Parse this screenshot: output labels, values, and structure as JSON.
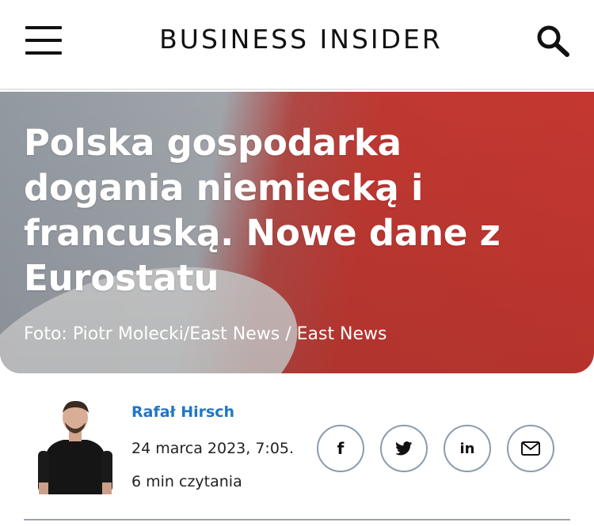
{
  "header": {
    "logo": "BUSINESS INSIDER",
    "menu_icon": "hamburger-menu-icon",
    "search_icon": "search-icon"
  },
  "article": {
    "title": "Polska gospodarka dogania niemiecką i francuską. Nowe dane z Eurostatu",
    "photo_credit": "Foto: Piotr Molecki/East News / East News"
  },
  "author": {
    "name": "Rafał Hirsch",
    "date": "24 marca 2023, 7:05.",
    "read_time": "6 min czytania"
  },
  "share": {
    "facebook": "f",
    "linkedin": "in"
  },
  "colors": {
    "link_blue": "#1f76c8",
    "share_border": "#8d9cab",
    "hero_red": "#cf3a33"
  }
}
